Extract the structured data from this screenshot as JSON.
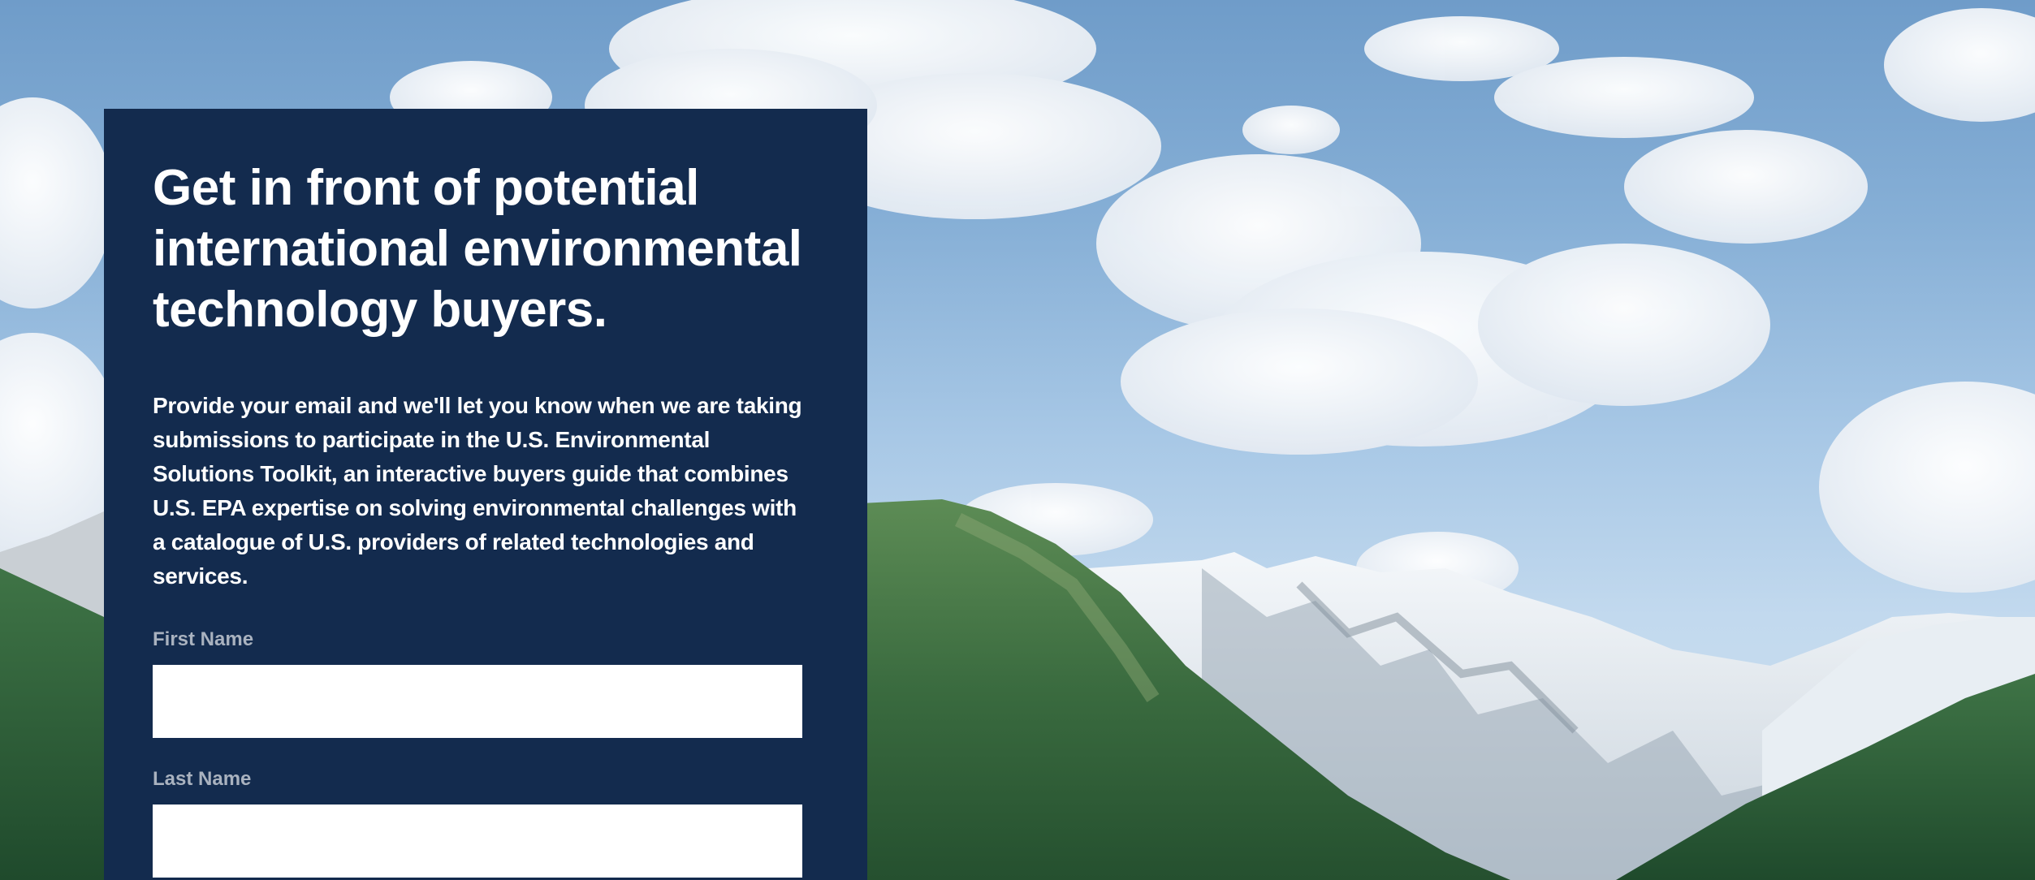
{
  "signup": {
    "headline": "Get in front of potential international environmental technology buyers.",
    "intro": "Provide your email and we'll let you know when we are taking submissions to participate in the U.S. Environmental Solutions Toolkit, an interactive buyers guide that combines U.S. EPA expertise on solving environmental challenges with a catalogue of U.S. providers of related technologies and services.",
    "first_name_label": "First Name",
    "first_name_value": "",
    "last_name_label": "Last Name",
    "last_name_value": ""
  },
  "colors": {
    "card_background": "#132b4e",
    "label_text": "#a9b2bf",
    "text": "#ffffff"
  }
}
